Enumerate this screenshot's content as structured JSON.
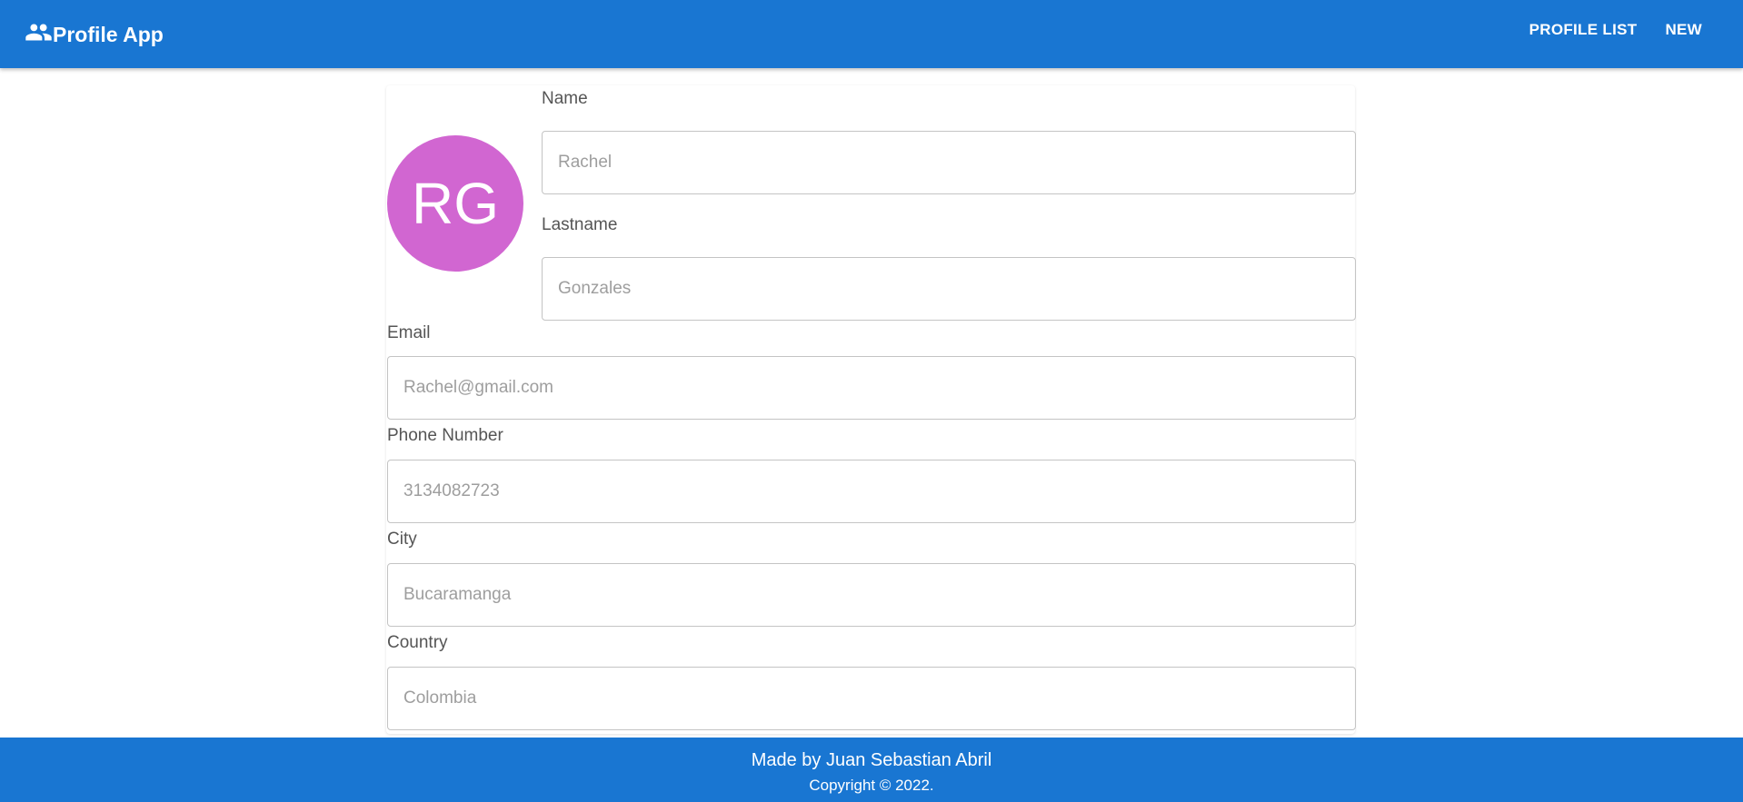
{
  "appbar": {
    "brand_icon": "people-icon",
    "title": "Profile App",
    "nav": [
      {
        "label": "PROFILE LIST"
      },
      {
        "label": "NEW"
      }
    ],
    "color": "#1976d2"
  },
  "profile": {
    "avatar_initials": "RG",
    "avatar_color": "#d166d1",
    "fields": {
      "name": {
        "label": "Name",
        "placeholder": "Rachel"
      },
      "lastname": {
        "label": "Lastname",
        "placeholder": "Gonzales"
      },
      "email": {
        "label": "Email",
        "placeholder": "Rachel@gmail.com"
      },
      "phone": {
        "label": "Phone Number",
        "placeholder": "3134082723"
      },
      "city": {
        "label": "City",
        "placeholder": "Bucaramanga"
      },
      "country": {
        "label": "Country",
        "placeholder": "Colombia"
      }
    }
  },
  "footer": {
    "made_by": "Made by Juan Sebastian Abril",
    "copyright": "Copyright © 2022."
  }
}
